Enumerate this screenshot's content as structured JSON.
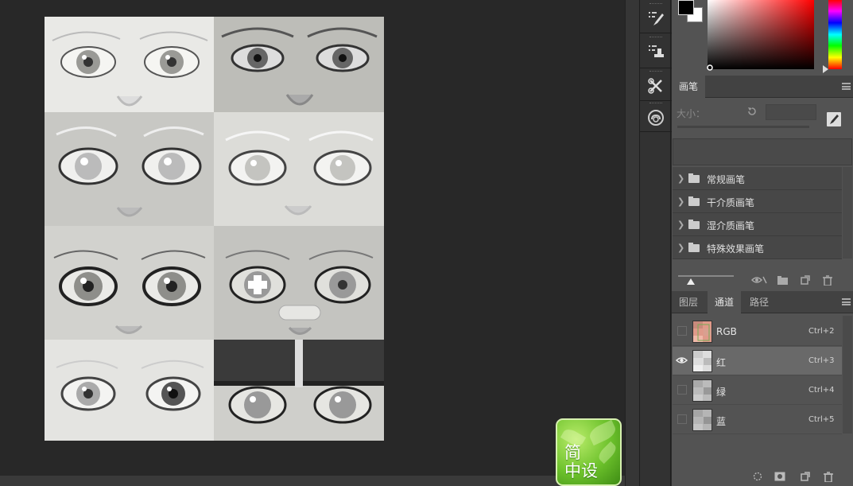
{
  "watermark": {
    "line1": "简",
    "line2": "中设"
  },
  "toolstrip": {
    "tools": [
      {
        "icon": "brush-presets-icon"
      },
      {
        "icon": "clone-source-icon"
      },
      {
        "icon": "tool-presets-icon"
      },
      {
        "icon": "creative-cloud-icon"
      }
    ]
  },
  "colors": {
    "foreground": "#000000",
    "background": "#ffffff"
  },
  "brush_panel": {
    "tab": "画笔",
    "size_label": "大小：",
    "size_value": "",
    "groups": [
      {
        "name": "常规画笔"
      },
      {
        "name": "干介质画笔"
      },
      {
        "name": "湿介质画笔"
      },
      {
        "name": "特殊效果画笔"
      }
    ]
  },
  "layers_panel": {
    "tabs": [
      {
        "label": "图层"
      },
      {
        "label": "通道",
        "active": true
      },
      {
        "label": "路径"
      }
    ],
    "channels": [
      {
        "name": "RGB",
        "shortcut": "Ctrl+2",
        "visible": false,
        "selected": false
      },
      {
        "name": "红",
        "shortcut": "Ctrl+3",
        "visible": true,
        "selected": true
      },
      {
        "name": "绿",
        "shortcut": "Ctrl+4",
        "visible": false,
        "selected": false
      },
      {
        "name": "蓝",
        "shortcut": "Ctrl+5",
        "visible": false,
        "selected": false
      }
    ]
  }
}
